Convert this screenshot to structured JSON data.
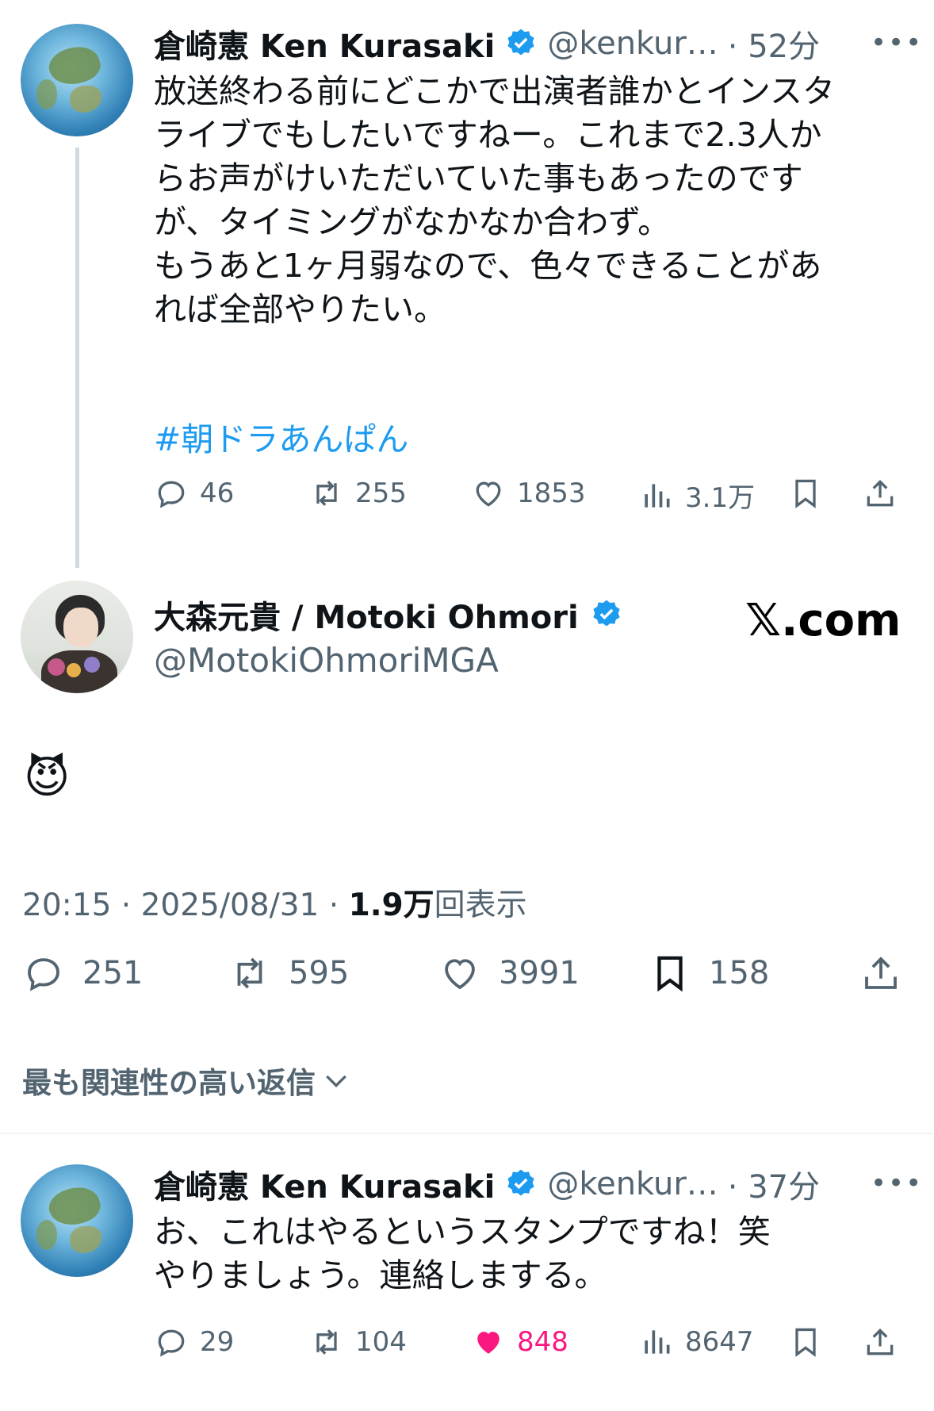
{
  "tweet1": {
    "name": "倉崎憲 Ken Kurasaki",
    "handle": "@kenkur…",
    "time": "· 52分",
    "text": "放送終わる前にどこかで出演者誰かとインスタ\nライブでもしたいですねー。これまで2.3人か\nらお声がけいただいていた事もあったのです\nが、タイミングがなかなか合わず。\nもうあと1ヶ月弱なので、色々できることがあ\nれば全部やりたい。",
    "hashtag": "#朝ドラあんぱん",
    "replies": "46",
    "retweets": "255",
    "likes": "1853",
    "views": "3.1万"
  },
  "main": {
    "name": "大森元貴 / Motoki Ohmori",
    "handle": "@MotokiOhmoriMGA",
    "site": "𝕏.com",
    "emoji": "😈",
    "time": "20:15 · 2025/08/31 · ",
    "views_bold": "1.9万",
    "views_suffix": "回表示",
    "replies": "251",
    "retweets": "595",
    "likes": "3991",
    "bookmarks": "158",
    "sort_label": "最も関連性の高い返信"
  },
  "tweet2": {
    "name": "倉崎憲 Ken Kurasaki",
    "handle": "@kenkur…",
    "time": "· 37分",
    "text": "お、これはやるというスタンプですね！笑\nやりましょう。連絡しまする。",
    "replies": "29",
    "retweets": "104",
    "likes": "848",
    "views": "8647"
  },
  "colors": {
    "accent": "#1d9bf0",
    "like_active": "#f91880",
    "muted": "#536471"
  },
  "icons": [
    "reply-icon",
    "retweet-icon",
    "like-icon",
    "views-icon",
    "bookmark-icon",
    "share-icon",
    "verified-icon",
    "more-icon",
    "chevron-down-icon"
  ]
}
